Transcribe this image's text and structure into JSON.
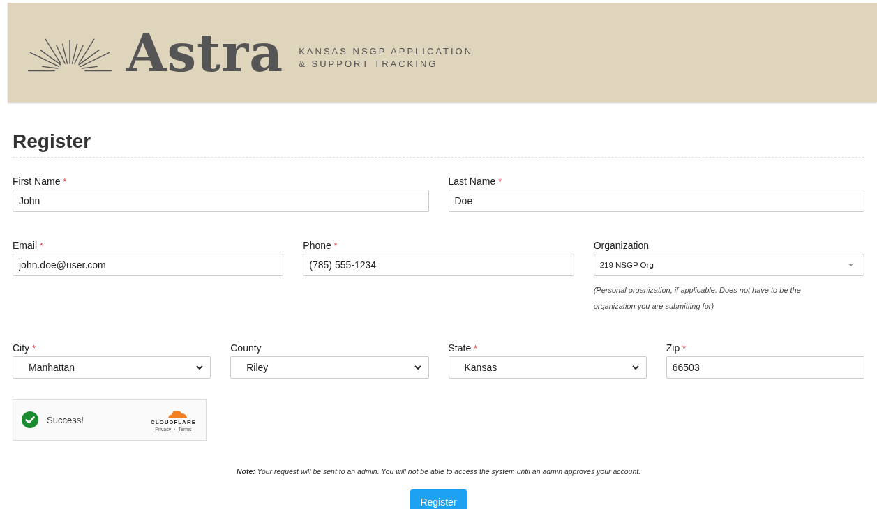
{
  "header": {
    "logo_text": "Astra",
    "tagline": [
      "KANSAS NSGP APPLICATION",
      "& SUPPORT TRACKING"
    ]
  },
  "form": {
    "title": "Register",
    "groups": [
      {
        "fields": [
          {
            "kind": "text",
            "label": "First Name",
            "required_mark": "*",
            "value": "John"
          },
          {
            "kind": "text",
            "label": "Last Name",
            "required_mark": "*",
            "value": "Doe"
          }
        ]
      },
      {
        "fields": [
          {
            "kind": "text",
            "label": "Email",
            "required_mark": "*",
            "value": "john.doe@user.com"
          },
          {
            "kind": "text",
            "label": "Phone",
            "required_mark": "*",
            "value": "(785) 555-1234"
          },
          {
            "kind": "combo",
            "label": "Organization",
            "value": "219 NSGP Org",
            "help": "(Personal organization, if applicable. Does not have to be the organization you are submitting for)"
          }
        ]
      },
      {
        "fields": [
          {
            "kind": "select",
            "label": "City",
            "required_mark": "*",
            "value": "Manhattan"
          },
          {
            "kind": "select",
            "label": "County",
            "value": "Riley"
          },
          {
            "kind": "select",
            "label": "State",
            "required_mark": "*",
            "value": "Kansas"
          },
          {
            "kind": "text",
            "label": "Zip",
            "required_mark": "*",
            "value": "66503"
          }
        ]
      }
    ],
    "captcha": {
      "status": "Success!",
      "brand": "CLOUDFLARE",
      "links": [
        "Privacy",
        "Terms"
      ],
      "separator": "·"
    },
    "note": "**Note:** Your request will be sent to an admin. You will not be able to access the system until an admin approves your account.",
    "submit": "Register"
  }
}
